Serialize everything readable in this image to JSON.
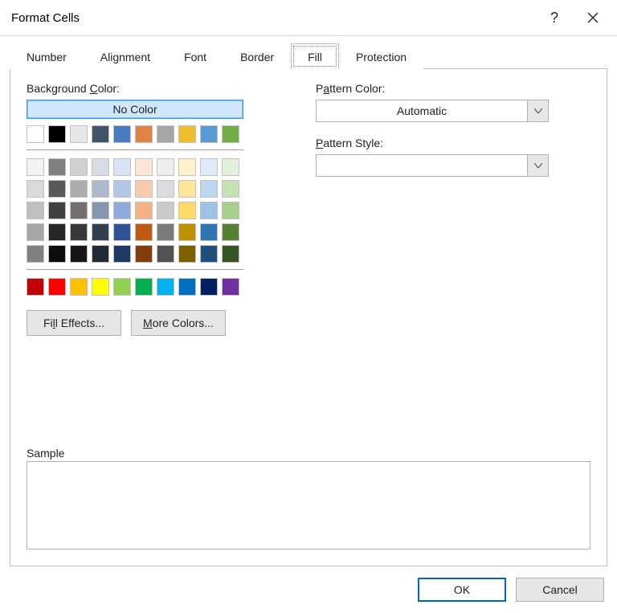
{
  "title": "Format Cells",
  "help_tooltip": "?",
  "tabs": {
    "number": "Number",
    "alignment": "Alignment",
    "font": "Font",
    "border": "Border",
    "fill": "Fill",
    "protection": "Protection",
    "active": "fill"
  },
  "fill": {
    "bg_label_pre": "Background ",
    "bg_label_u": "C",
    "bg_label_post": "olor:",
    "no_color": "No Color",
    "fill_effects_pre": "Fi",
    "fill_effects_u": "l",
    "fill_effects_post": "l Effects...",
    "more_colors_u": "M",
    "more_colors_post": "ore Colors...",
    "sample_label": "Sample"
  },
  "pattern": {
    "color_label_pre": "P",
    "color_label_u": "a",
    "color_label_post": "ttern Color:",
    "color_value": "Automatic",
    "style_label_u": "P",
    "style_label_post": "attern Style:",
    "style_value": ""
  },
  "footer": {
    "ok": "OK",
    "cancel": "Cancel"
  },
  "swatches": {
    "theme_row": [
      "#ffffff",
      "#000000",
      "#e7e6e6",
      "#435369",
      "#4a7ac0",
      "#e08244",
      "#a5a5a5",
      "#f0bd2b",
      "#5b9bd5",
      "#70ad47"
    ],
    "tints": [
      [
        "#f2f2f2",
        "#808080",
        "#d0cece",
        "#d6dce4",
        "#dae3f3",
        "#fbe5d6",
        "#ededed",
        "#fff2cc",
        "#deebf7",
        "#e2efda"
      ],
      [
        "#d9d9d9",
        "#595959",
        "#aeabab",
        "#adb9ca",
        "#b4c6e7",
        "#f7cbac",
        "#dbdbdb",
        "#fee599",
        "#bdd7ee",
        "#c5e0b3"
      ],
      [
        "#bfbfbf",
        "#404040",
        "#757070",
        "#8496b0",
        "#8faadc",
        "#f4b183",
        "#c9c9c9",
        "#ffd965",
        "#9cc3e5",
        "#a8d08d"
      ],
      [
        "#a6a6a6",
        "#262626",
        "#3b3838",
        "#323f4f",
        "#2e5396",
        "#c05a11",
        "#7b7b7b",
        "#bf9000",
        "#2f75b5",
        "#538135"
      ],
      [
        "#808080",
        "#0d0d0d",
        "#171616",
        "#222a35",
        "#203864",
        "#843c0b",
        "#525252",
        "#7f6000",
        "#1e4e79",
        "#375623"
      ]
    ],
    "standard": [
      "#c00000",
      "#ff0000",
      "#ffc000",
      "#ffff00",
      "#92d050",
      "#00b050",
      "#00b0f0",
      "#0070c0",
      "#002060",
      "#7030a0"
    ]
  }
}
